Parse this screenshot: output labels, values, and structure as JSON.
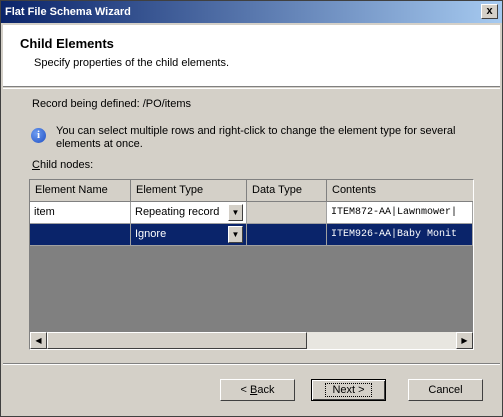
{
  "window": {
    "title": "Flat File Schema Wizard",
    "close": "x"
  },
  "header": {
    "title": "Child Elements",
    "subtitle": "Specify properties of the child elements."
  },
  "record": {
    "label": "Record being defined:",
    "value": "/PO/items"
  },
  "info": {
    "text": "You can select multiple rows and right-click to change the element type for several elements at once."
  },
  "child_nodes": {
    "label_prefix": "C",
    "label_rest": "hild nodes:"
  },
  "grid": {
    "columns": [
      "Element Name",
      "Element Type",
      "Data Type",
      "Contents"
    ],
    "rows": [
      {
        "name": "item",
        "type": "Repeating record",
        "data_type": "",
        "contents": "ITEM872-AA|Lawnmower|",
        "selected": false
      },
      {
        "name": "",
        "type": "Ignore",
        "data_type": "",
        "contents": "ITEM926-AA|Baby Monit",
        "selected": true
      }
    ]
  },
  "buttons": {
    "back_prefix": "< ",
    "back_accel": "B",
    "back_rest": "ack",
    "next": "Next >",
    "cancel": "Cancel"
  }
}
